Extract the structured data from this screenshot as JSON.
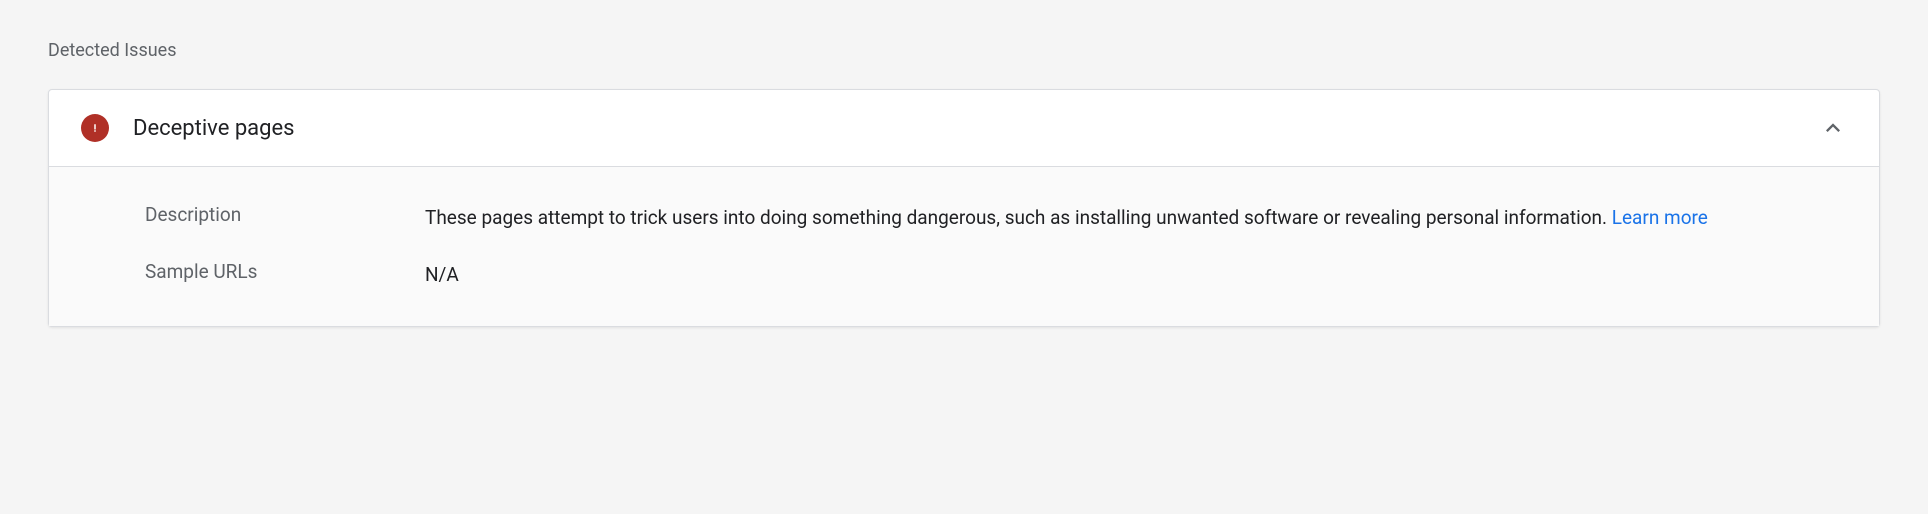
{
  "section": {
    "title": "Detected Issues"
  },
  "issue": {
    "title": "Deceptive pages",
    "description_label": "Description",
    "description_text": "These pages attempt to trick users into doing something dangerous, such as installing unwanted software or revealing personal information. ",
    "learn_more": "Learn more",
    "sample_urls_label": "Sample URLs",
    "sample_urls_value": "N/A"
  },
  "icons": {
    "error": "error-icon",
    "chevron_up": "chevron-up-icon"
  },
  "colors": {
    "error_badge": "#b03027",
    "link": "#1a73e8",
    "muted": "#5f6368"
  }
}
